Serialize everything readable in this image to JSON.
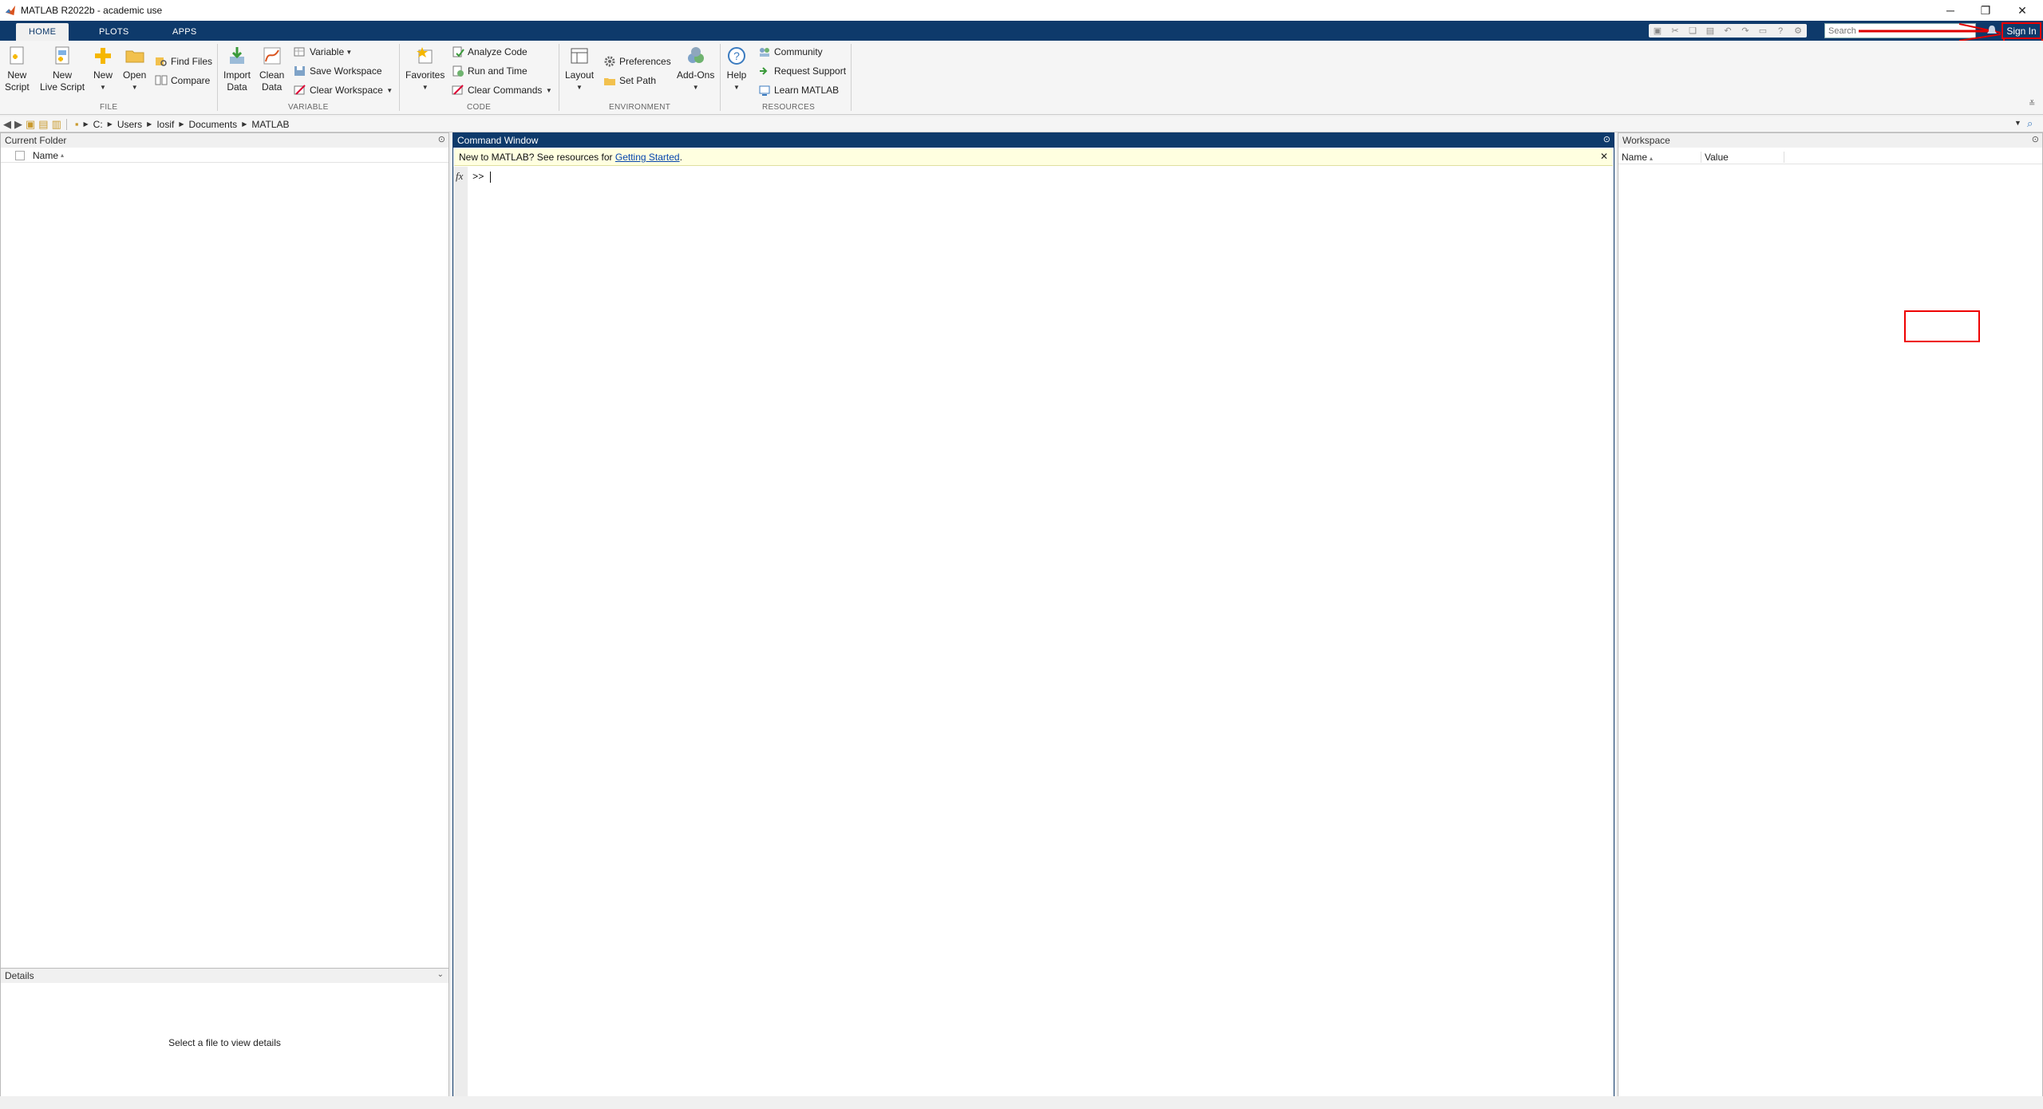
{
  "window": {
    "title": "MATLAB R2022b - academic use",
    "minimize_glyph": "─",
    "restore_glyph": "❐",
    "close_glyph": "✕"
  },
  "tabs": [
    {
      "label": "HOME",
      "active": true
    },
    {
      "label": "PLOTS",
      "active": false
    },
    {
      "label": "APPS",
      "active": false
    }
  ],
  "search": {
    "placeholder": "Search"
  },
  "signin": {
    "label": "Sign In"
  },
  "ribbon": {
    "file": {
      "label": "FILE",
      "new_script": [
        "New",
        "Script"
      ],
      "new_live_script": [
        "New",
        "Live Script"
      ],
      "new": "New",
      "open": "Open",
      "find_files": "Find Files",
      "compare": "Compare"
    },
    "variable": {
      "label": "VARIABLE",
      "import_data": [
        "Import",
        "Data"
      ],
      "clean_data": [
        "Clean",
        "Data"
      ],
      "variable": "Variable",
      "save_workspace": "Save Workspace",
      "clear_workspace": "Clear Workspace"
    },
    "code": {
      "label": "CODE",
      "favorites": "Favorites",
      "analyze_code": "Analyze Code",
      "run_and_time": "Run and Time",
      "clear_commands": "Clear Commands"
    },
    "environment": {
      "label": "ENVIRONMENT",
      "layout": "Layout",
      "preferences": "Preferences",
      "set_path": "Set Path",
      "add_ons": "Add-Ons"
    },
    "resources": {
      "label": "RESOURCES",
      "help": "Help",
      "community": "Community",
      "request_support": "Request Support",
      "learn_matlab": "Learn MATLAB"
    }
  },
  "address": {
    "crumbs": [
      "C:",
      "Users",
      "Iosif",
      "Documents",
      "MATLAB"
    ]
  },
  "current_folder": {
    "title": "Current Folder",
    "col_name": "Name",
    "sort_glyph": "▴"
  },
  "details": {
    "title": "Details",
    "message": "Select a file to view details"
  },
  "command_window": {
    "title": "Command Window",
    "notice_prefix": "New to MATLAB? See resources for ",
    "notice_link": "Getting Started",
    "notice_suffix": ".",
    "fx": "fx",
    "prompt": ">>"
  },
  "workspace": {
    "title": "Workspace",
    "col_name": "Name",
    "col_value": "Value"
  },
  "colors": {
    "brand": "#0e3a6b",
    "notice_bg": "#ffffe0",
    "annotation_red": "#e00000"
  }
}
